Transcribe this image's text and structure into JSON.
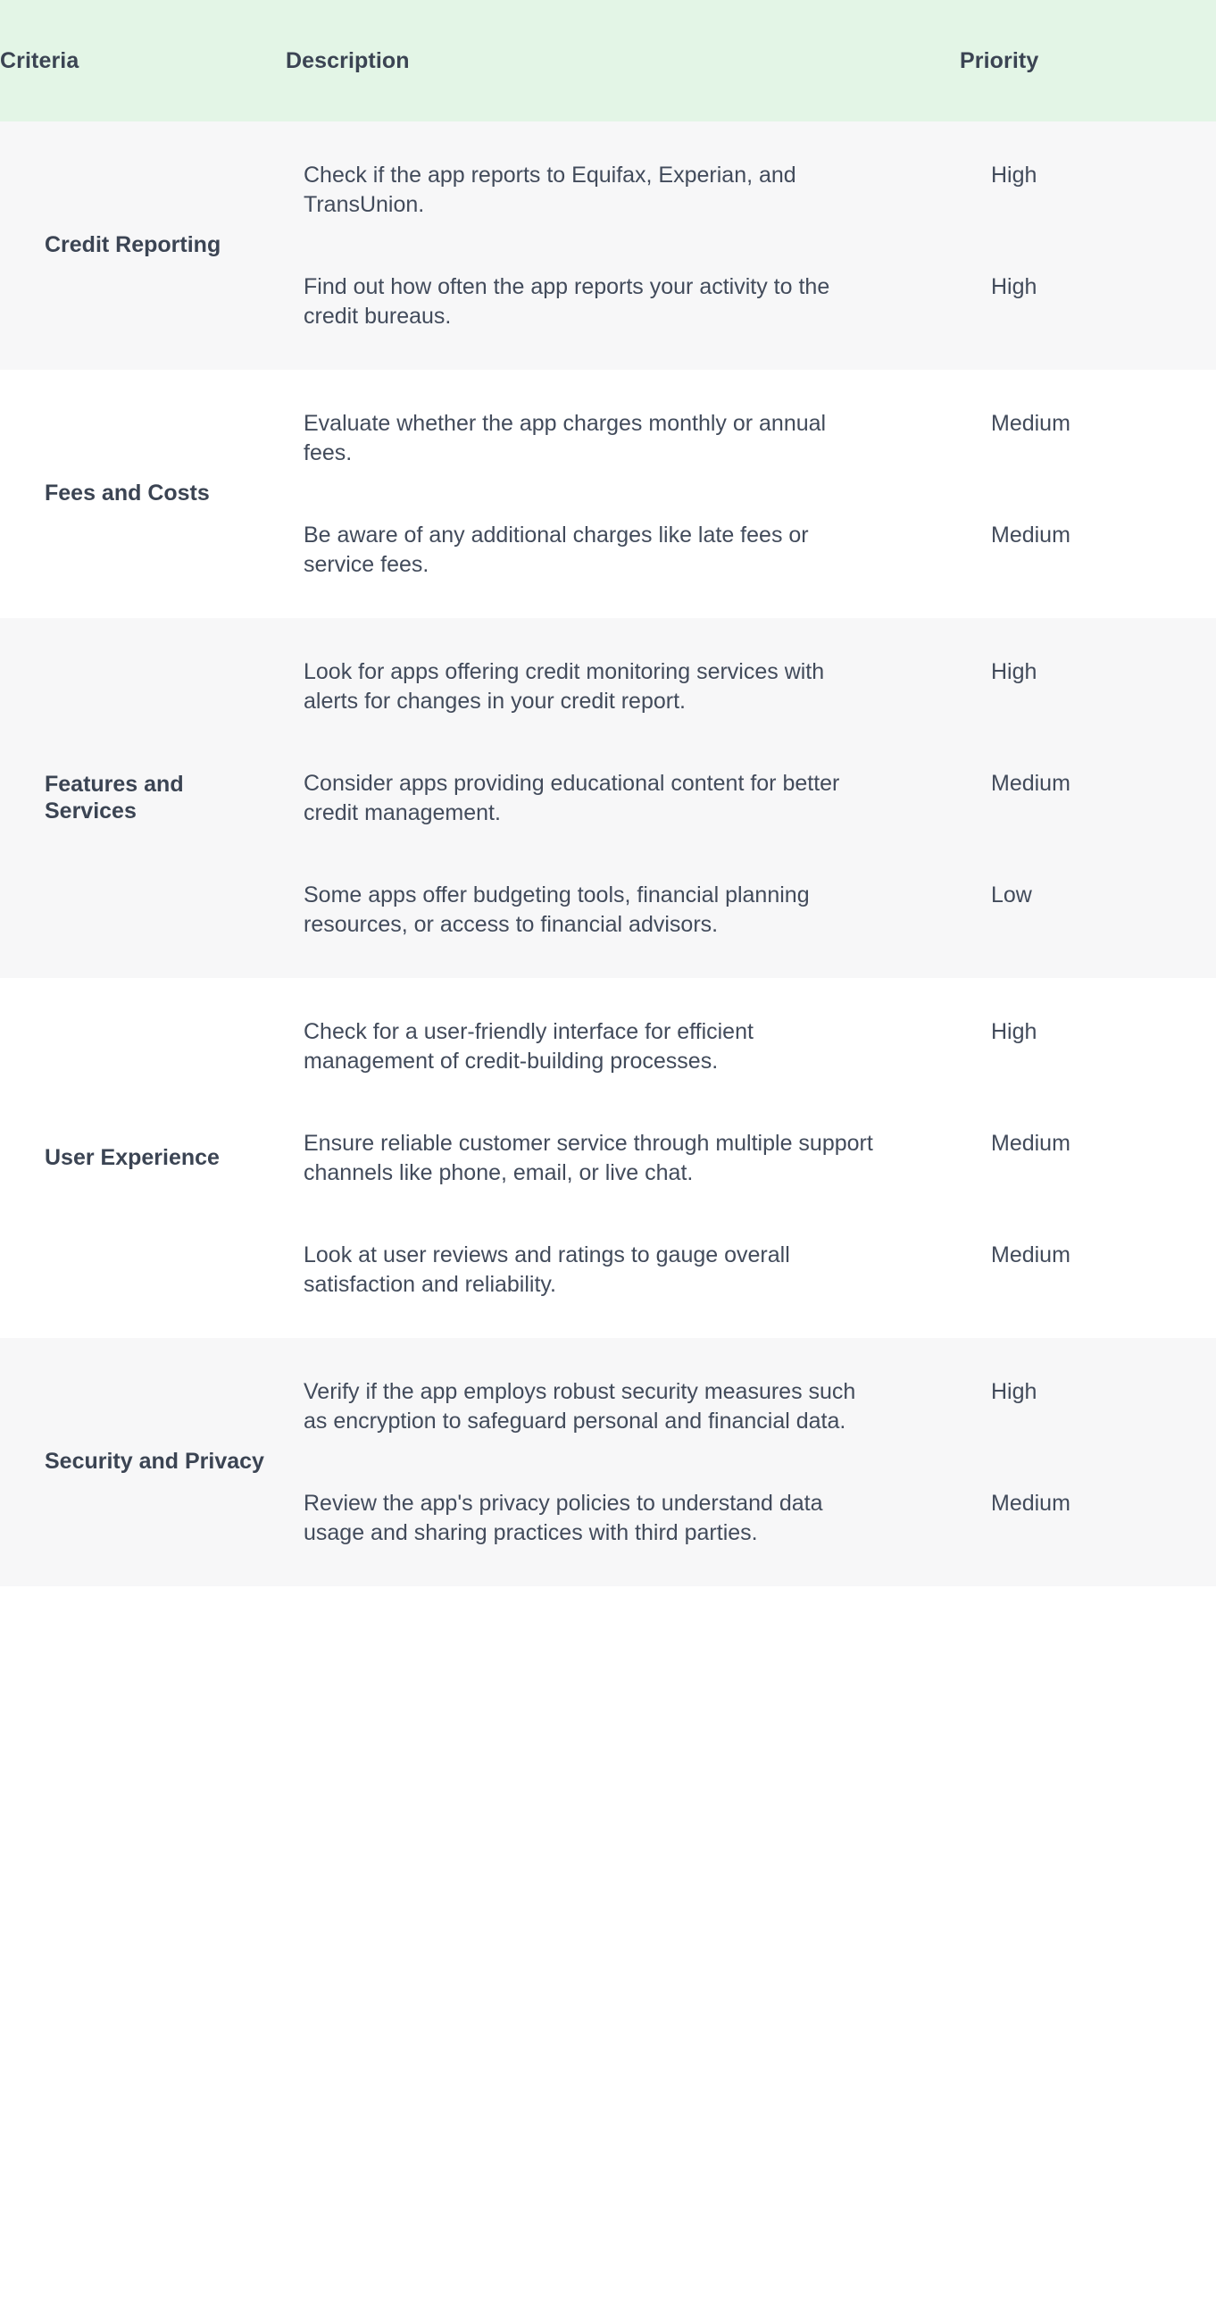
{
  "table": {
    "columns": [
      {
        "key": "criteria",
        "label": "Criteria"
      },
      {
        "key": "description",
        "label": "Description"
      },
      {
        "key": "priority",
        "label": "Priority"
      }
    ],
    "colors": {
      "header_background": "#e3f5e6",
      "header_text": "#3b4453",
      "row_shaded_background": "#f7f7f8",
      "row_plain_background": "#ffffff",
      "body_text": "#424b5b",
      "criteria_text": "#3b4453"
    },
    "groups": [
      {
        "criteria": "Credit Reporting",
        "shaded": true,
        "rows": [
          {
            "description": "Check if the app reports to Equifax, Experian, and TransUnion.",
            "priority": "High"
          },
          {
            "description": "Find out how often the app reports your activity to the credit bureaus.",
            "priority": "High"
          }
        ]
      },
      {
        "criteria": "Fees and Costs",
        "shaded": false,
        "rows": [
          {
            "description": "Evaluate whether the app charges monthly or annual fees.",
            "priority": "Medium"
          },
          {
            "description": "Be aware of any additional charges like late fees or service fees.",
            "priority": "Medium"
          }
        ]
      },
      {
        "criteria": "Features and Services",
        "shaded": true,
        "rows": [
          {
            "description": "Look for apps offering credit monitoring services with alerts for changes in your credit report.",
            "priority": "High"
          },
          {
            "description": "Consider apps providing educational content for better credit management.",
            "priority": "Medium"
          },
          {
            "description": "Some apps offer budgeting tools, financial planning resources, or access to financial advisors.",
            "priority": "Low"
          }
        ]
      },
      {
        "criteria": "User Experience",
        "shaded": false,
        "rows": [
          {
            "description": "Check for a user-friendly interface for efficient management of credit-building processes.",
            "priority": "High"
          },
          {
            "description": "Ensure reliable customer service through multiple support channels like phone, email, or live chat.",
            "priority": "Medium"
          },
          {
            "description": "Look at user reviews and ratings to gauge overall satisfaction and reliability.",
            "priority": "Medium"
          }
        ]
      },
      {
        "criteria": "Security and Privacy",
        "shaded": true,
        "rows": [
          {
            "description": "Verify if the app employs robust security measures such as encryption to safeguard personal and financial data.",
            "priority": "High"
          },
          {
            "description": "Review the app's privacy policies to understand data usage and sharing practices with third parties.",
            "priority": "Medium"
          }
        ]
      }
    ]
  }
}
